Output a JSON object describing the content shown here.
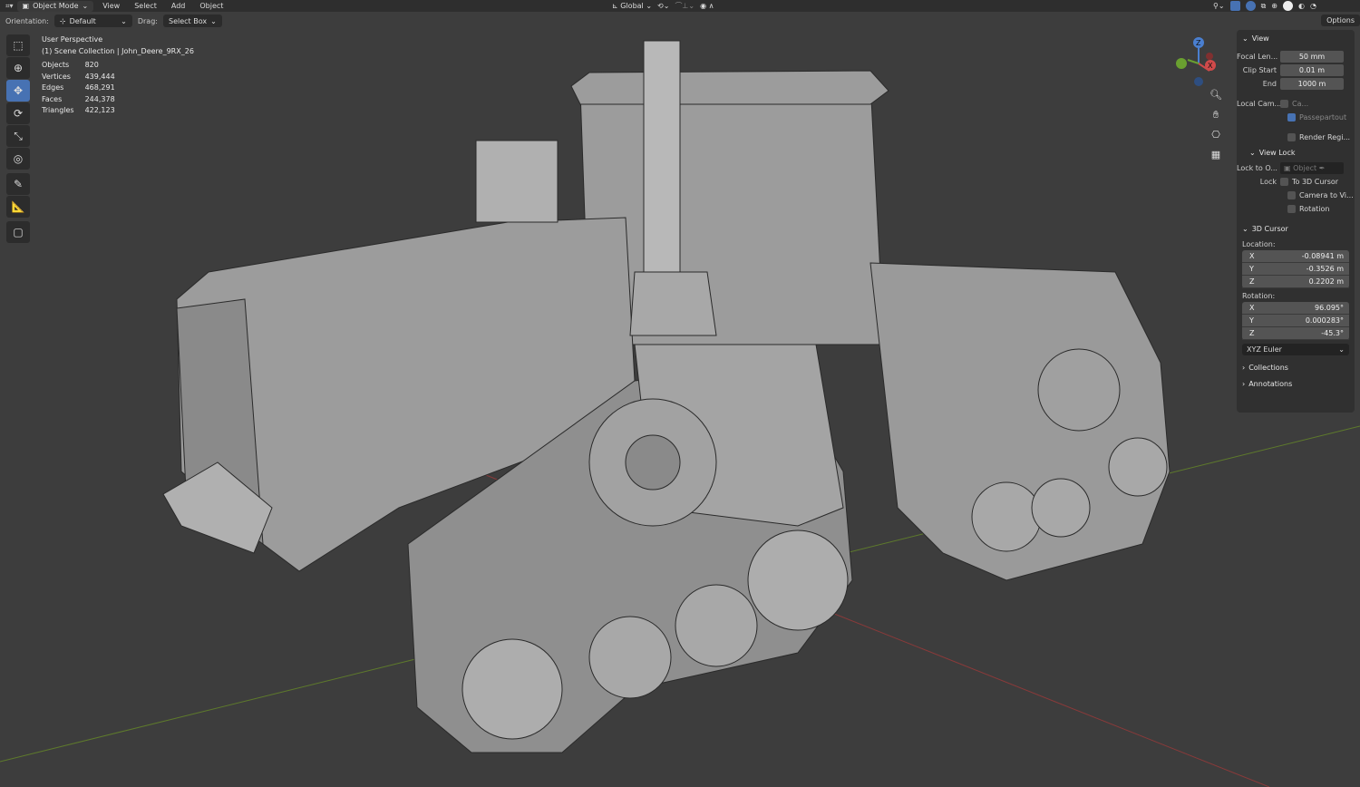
{
  "header": {
    "mode": "Object Mode",
    "menus": [
      "View",
      "Select",
      "Add",
      "Object"
    ],
    "orientation_label": "Orientation:",
    "orientation": "Default",
    "drag_label": "Drag:",
    "drag": "Select Box",
    "transform_orientation": "Global",
    "options": "Options"
  },
  "toolbar": {
    "tools": [
      "select-box",
      "cursor",
      "move",
      "rotate",
      "scale",
      "transform",
      "annotate",
      "measure",
      "add-cube"
    ],
    "active": "move",
    "active_color": "#4772b3"
  },
  "overlay": {
    "perspective": "User Perspective",
    "collection": "(1) Scene Collection | John_Deere_9RX_26",
    "stats": [
      {
        "label": "Objects",
        "value": "820"
      },
      {
        "label": "Vertices",
        "value": "439,444"
      },
      {
        "label": "Edges",
        "value": "468,291"
      },
      {
        "label": "Faces",
        "value": "244,378"
      },
      {
        "label": "Triangles",
        "value": "422,123"
      }
    ]
  },
  "gizmo": {
    "z": "Z",
    "x": "X",
    "y": "Y"
  },
  "panel": {
    "view": {
      "title": "View",
      "focal_label": "Focal Len...",
      "focal": "50 mm",
      "clip_start_label": "Clip Start",
      "clip_start": "0.01 m",
      "end_label": "End",
      "end": "1000 m",
      "local_cam_label": "Local Cam...",
      "local_cam": "Ca...",
      "passepartout": "Passepartout",
      "render_region": "Render Regi..."
    },
    "view_lock": {
      "title": "View Lock",
      "lock_to_label": "Lock to O...",
      "lock_to": "Object",
      "lock_label": "Lock",
      "to_cursor": "To 3D Cursor",
      "camera_to_view": "Camera to Vi...",
      "rotation": "Rotation"
    },
    "cursor": {
      "title": "3D Cursor",
      "location_label": "Location:",
      "location": [
        {
          "axis": "X",
          "value": "-0.08941 m"
        },
        {
          "axis": "Y",
          "value": "-0.3526 m"
        },
        {
          "axis": "Z",
          "value": "0.2202 m"
        }
      ],
      "rotation_label": "Rotation:",
      "rotation": [
        {
          "axis": "X",
          "value": "96.095°"
        },
        {
          "axis": "Y",
          "value": "0.000283°"
        },
        {
          "axis": "Z",
          "value": "-45.3°"
        }
      ],
      "mode": "XYZ Euler"
    },
    "collections": "Collections",
    "annotations": "Annotations"
  }
}
